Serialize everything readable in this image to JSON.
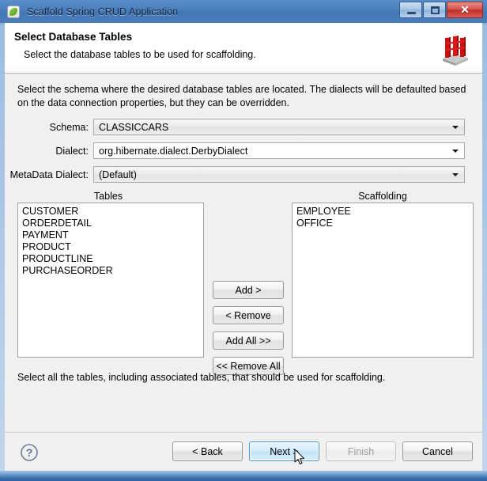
{
  "window": {
    "title": "Scaffold Spring CRUD Application",
    "app_icon": "leaf-icon",
    "controls": {
      "minimize": "minimize-icon",
      "maximize": "maximize-icon",
      "close": "✕"
    }
  },
  "header": {
    "title": "Select Database Tables",
    "subtitle": "Select the database tables to be used for scaffolding.",
    "logo": "scaffolding-icon"
  },
  "body": {
    "intro": "Select the schema where the desired database tables are located. The dialects will be defaulted based on the data connection properties, but they can be overridden.",
    "fields": [
      {
        "label": "Schema:",
        "value": "CLASSICCARS",
        "editable": false
      },
      {
        "label": "Dialect:",
        "value": "org.hibernate.dialect.DerbyDialect",
        "editable": true
      },
      {
        "label": "MetaData Dialect:",
        "value": "(Default)",
        "editable": false
      }
    ],
    "tables_caption": "Tables",
    "tables_items": [
      "CUSTOMER",
      "ORDERDETAIL",
      "PAYMENT",
      "PRODUCT",
      "PRODUCTLINE",
      "PURCHASEORDER"
    ],
    "scaffolding_caption": "Scaffolding",
    "scaffolding_items": [
      "EMPLOYEE",
      "OFFICE"
    ],
    "transfer_buttons": [
      "Add >",
      "< Remove",
      "Add All >>",
      "<< Remove All"
    ],
    "footnote": "Select all the tables, including associated tables, that should be used for scaffolding."
  },
  "footer": {
    "help": "help-icon",
    "buttons": [
      {
        "label": "< Back",
        "state": "normal"
      },
      {
        "label": "Next >",
        "state": "primary"
      },
      {
        "label": "Finish",
        "state": "disabled"
      },
      {
        "label": "Cancel",
        "state": "normal"
      }
    ]
  },
  "colors": {
    "titlebar": "#4a7ebb",
    "body": "#f0f0f0",
    "accent": "#bfe2f8",
    "logo_red": "#cc1111",
    "close_red": "#bd2c26"
  }
}
